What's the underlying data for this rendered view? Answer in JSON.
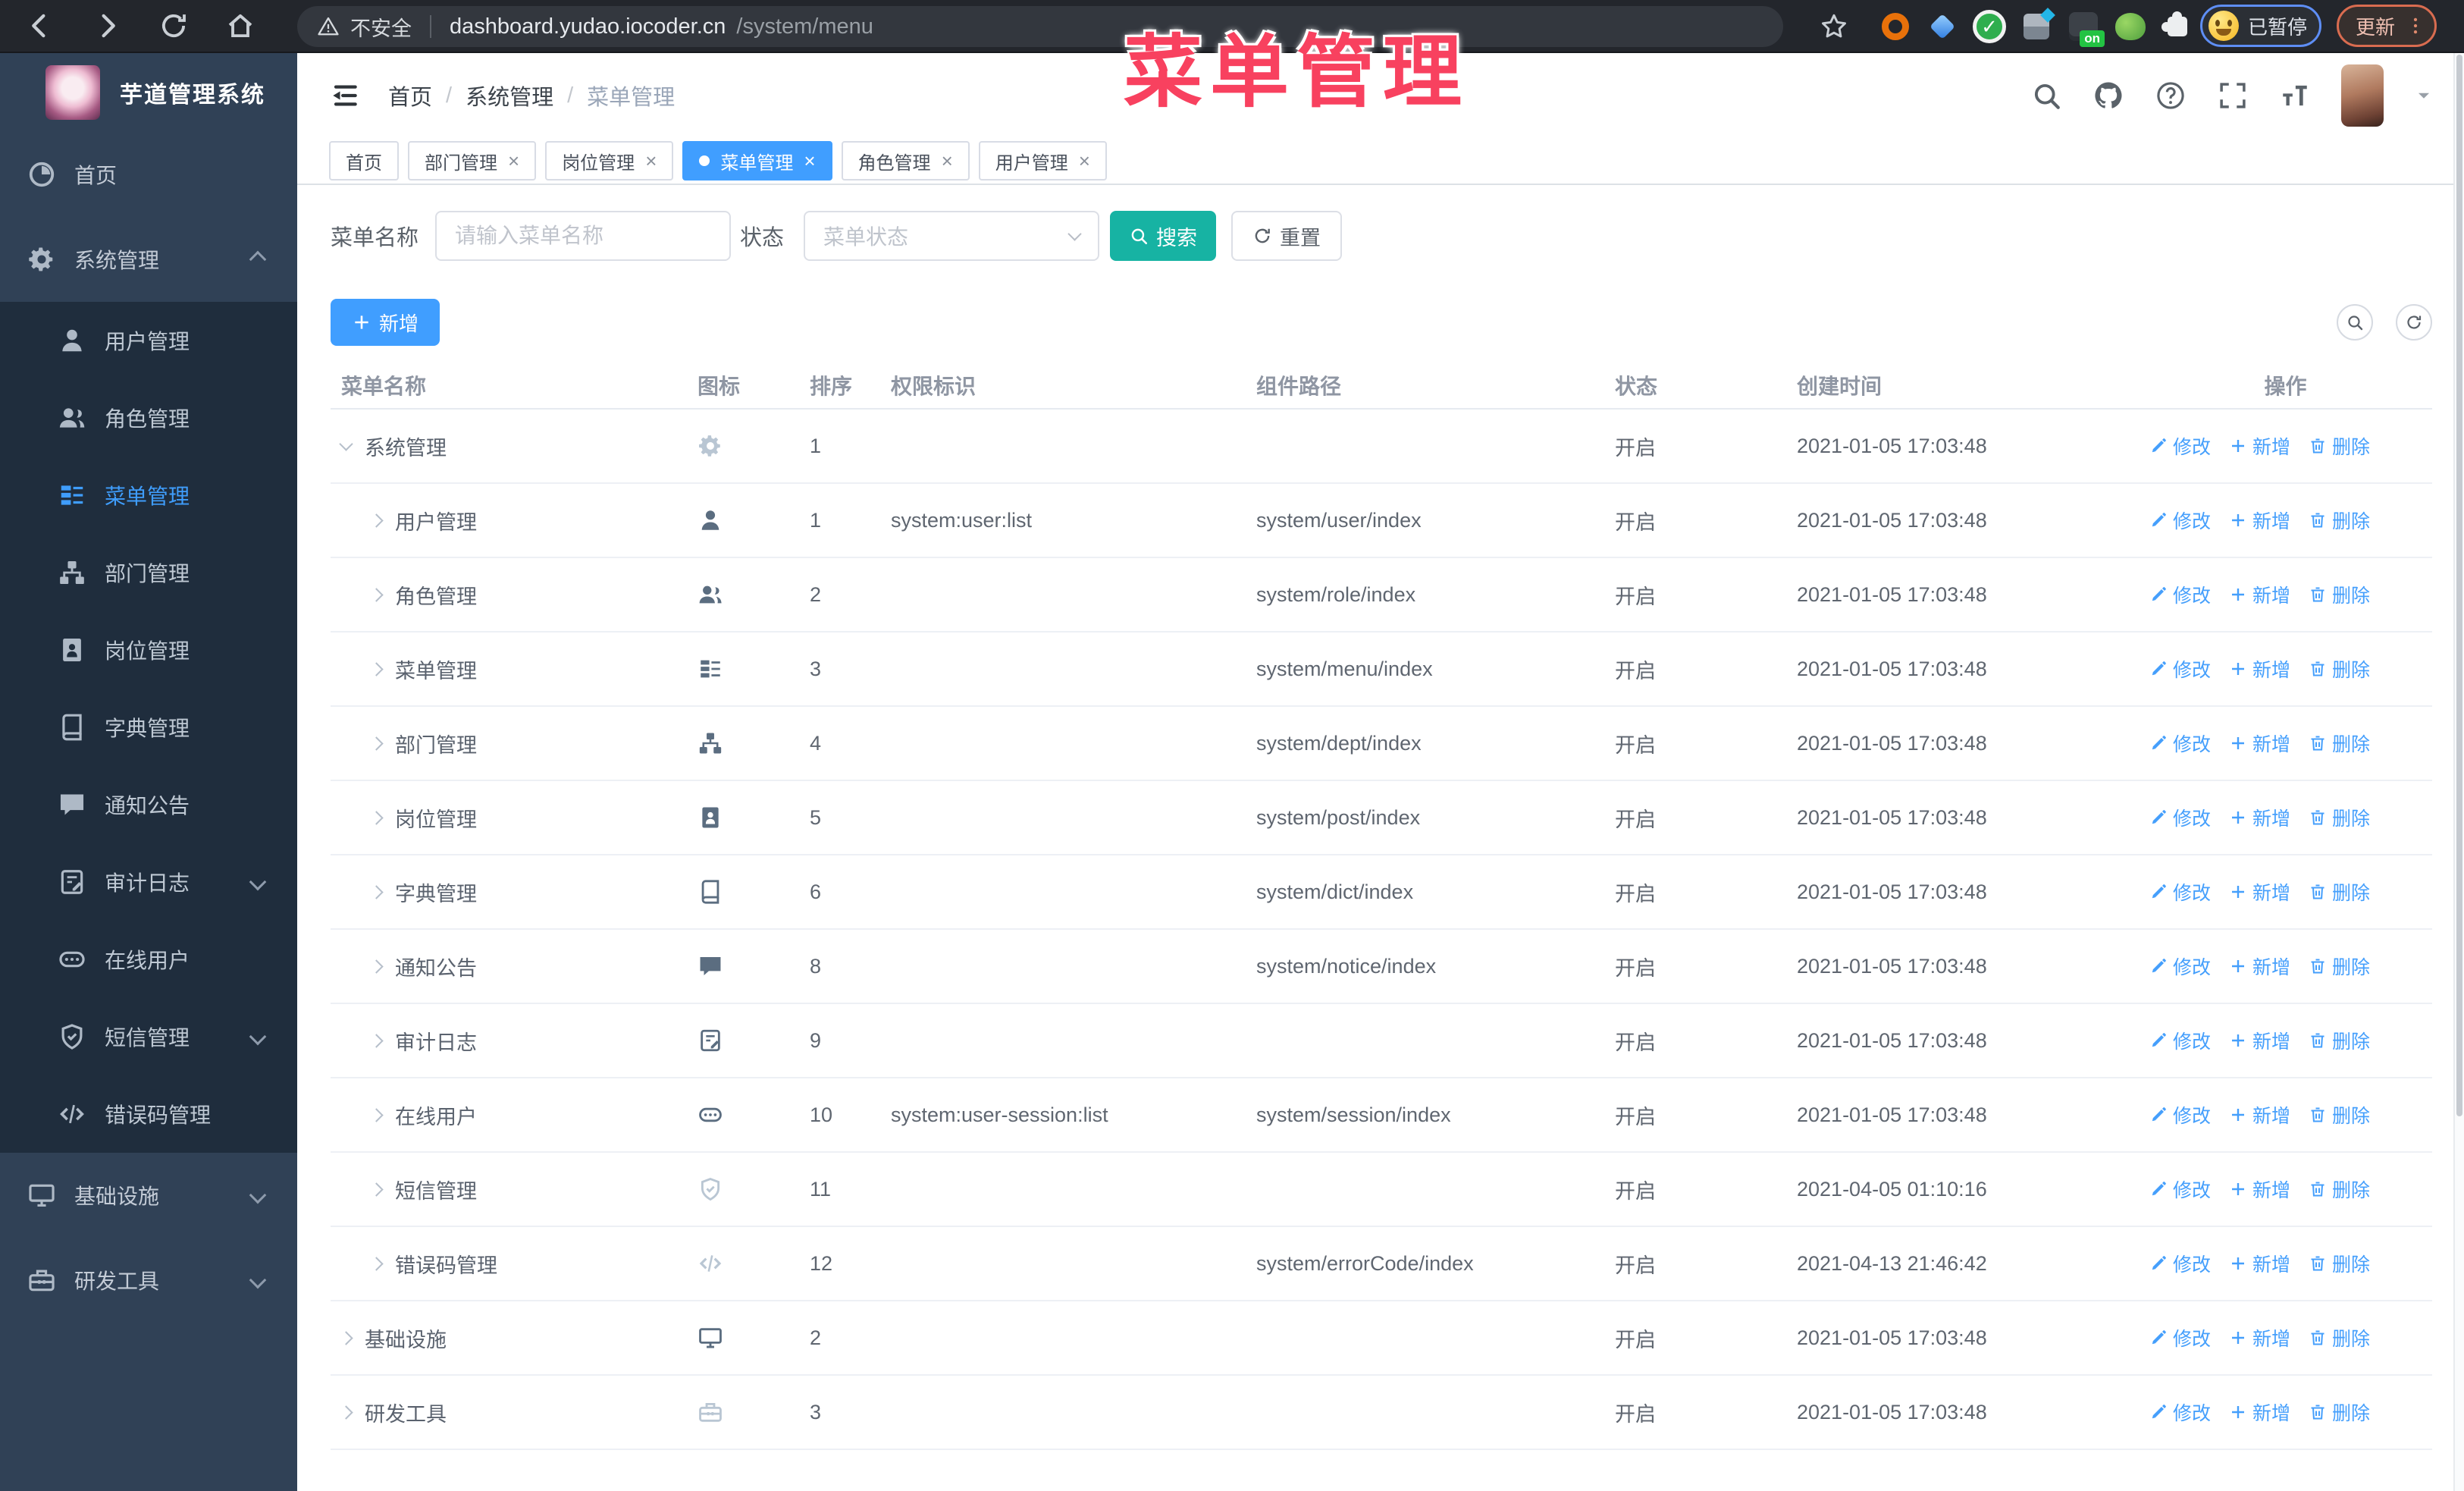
{
  "browser": {
    "security_label": "不安全",
    "url_host": "dashboard.yudao.iocoder.cn",
    "url_path": "/system/menu",
    "paused_badge": "已暂停",
    "update_button": "更新",
    "nav_icons": [
      "back-icon",
      "forward-icon",
      "reload-icon",
      "home-icon"
    ],
    "extensions": [
      "orange-ring-extension-icon",
      "blue-gem-extension-icon",
      "green-check-extension-icon",
      "tiles-extension-icon",
      "dark-on-extension-icon",
      "frog-extension-icon",
      "puzzle-extension-icon"
    ]
  },
  "annotation": {
    "text": "菜单管理",
    "color": "#f8415f"
  },
  "sidebar": {
    "title": "芋道管理系统",
    "items": [
      {
        "key": "home",
        "label": "首页",
        "icon": "dashboard-icon",
        "level": 0
      },
      {
        "key": "system",
        "label": "系统管理",
        "icon": "gear-icon",
        "level": 0,
        "chevron": "up"
      },
      {
        "key": "user",
        "label": "用户管理",
        "icon": "user-icon",
        "level": 1
      },
      {
        "key": "role",
        "label": "角色管理",
        "icon": "users-icon",
        "level": 1
      },
      {
        "key": "menu",
        "label": "菜单管理",
        "icon": "menu-tree-icon",
        "level": 1,
        "active": true
      },
      {
        "key": "dept",
        "label": "部门管理",
        "icon": "org-tree-icon",
        "level": 1
      },
      {
        "key": "post",
        "label": "岗位管理",
        "icon": "badge-icon",
        "level": 1
      },
      {
        "key": "dict",
        "label": "字典管理",
        "icon": "book-icon",
        "level": 1
      },
      {
        "key": "notice",
        "label": "通知公告",
        "icon": "message-icon",
        "level": 1
      },
      {
        "key": "audit-log",
        "label": "审计日志",
        "icon": "log-icon",
        "level": 1,
        "chevron": "down"
      },
      {
        "key": "online-user",
        "label": "在线用户",
        "icon": "online-icon",
        "level": 1
      },
      {
        "key": "sms",
        "label": "短信管理",
        "icon": "shield-icon",
        "level": 1,
        "chevron": "down"
      },
      {
        "key": "error-code",
        "label": "错误码管理",
        "icon": "code-icon",
        "level": 1
      },
      {
        "key": "infra",
        "label": "基础设施",
        "icon": "monitor-icon",
        "level": 0,
        "chevron": "down"
      },
      {
        "key": "dev-tool",
        "label": "研发工具",
        "icon": "toolbox-icon",
        "level": 0,
        "chevron": "down"
      }
    ]
  },
  "header": {
    "breadcrumb": [
      "首页",
      "系统管理",
      "菜单管理"
    ],
    "icons": [
      "search-icon",
      "github-icon",
      "question-icon",
      "fullscreen-icon",
      "font-size-icon"
    ]
  },
  "tabs": [
    {
      "key": "home",
      "label": "首页"
    },
    {
      "key": "dept",
      "label": "部门管理",
      "closable": true
    },
    {
      "key": "post",
      "label": "岗位管理",
      "closable": true
    },
    {
      "key": "menu",
      "label": "菜单管理",
      "closable": true,
      "active": true
    },
    {
      "key": "role",
      "label": "角色管理",
      "closable": true
    },
    {
      "key": "user",
      "label": "用户管理",
      "closable": true
    }
  ],
  "filters": {
    "name_label": "菜单名称",
    "name_placeholder": "请输入菜单名称",
    "status_label": "状态",
    "status_placeholder": "菜单状态",
    "search_button": "搜索",
    "reset_button": "重置"
  },
  "toolbar": {
    "add_button": "新增"
  },
  "table": {
    "columns": [
      "菜单名称",
      "图标",
      "排序",
      "权限标识",
      "组件路径",
      "状态",
      "创建时间",
      "操作"
    ],
    "ops": [
      {
        "key": "edit",
        "label": "修改",
        "icon": "edit-icon"
      },
      {
        "key": "add",
        "label": "新增",
        "icon": "plus-icon"
      },
      {
        "key": "delete",
        "label": "删除",
        "icon": "trash-icon"
      }
    ],
    "rows": [
      {
        "name": "系统管理",
        "level": 0,
        "expanded": true,
        "icon": "gear-icon",
        "icon_muted": true,
        "sort": "1",
        "perm": "",
        "path": "",
        "status": "开启",
        "time": "2021-01-05 17:03:48"
      },
      {
        "name": "用户管理",
        "level": 1,
        "expanded": false,
        "icon": "user-icon",
        "icon_muted": false,
        "sort": "1",
        "perm": "system:user:list",
        "path": "system/user/index",
        "status": "开启",
        "time": "2021-01-05 17:03:48"
      },
      {
        "name": "角色管理",
        "level": 1,
        "expanded": false,
        "icon": "users-icon",
        "icon_muted": false,
        "sort": "2",
        "perm": "",
        "path": "system/role/index",
        "status": "开启",
        "time": "2021-01-05 17:03:48"
      },
      {
        "name": "菜单管理",
        "level": 1,
        "expanded": false,
        "icon": "menu-tree-icon",
        "icon_muted": false,
        "sort": "3",
        "perm": "",
        "path": "system/menu/index",
        "status": "开启",
        "time": "2021-01-05 17:03:48"
      },
      {
        "name": "部门管理",
        "level": 1,
        "expanded": false,
        "icon": "org-tree-icon",
        "icon_muted": false,
        "sort": "4",
        "perm": "",
        "path": "system/dept/index",
        "status": "开启",
        "time": "2021-01-05 17:03:48"
      },
      {
        "name": "岗位管理",
        "level": 1,
        "expanded": false,
        "icon": "badge-icon",
        "icon_muted": false,
        "sort": "5",
        "perm": "",
        "path": "system/post/index",
        "status": "开启",
        "time": "2021-01-05 17:03:48"
      },
      {
        "name": "字典管理",
        "level": 1,
        "expanded": false,
        "icon": "book-icon",
        "icon_muted": false,
        "sort": "6",
        "perm": "",
        "path": "system/dict/index",
        "status": "开启",
        "time": "2021-01-05 17:03:48"
      },
      {
        "name": "通知公告",
        "level": 1,
        "expanded": false,
        "icon": "message-icon",
        "icon_muted": false,
        "sort": "8",
        "perm": "",
        "path": "system/notice/index",
        "status": "开启",
        "time": "2021-01-05 17:03:48"
      },
      {
        "name": "审计日志",
        "level": 1,
        "expanded": false,
        "icon": "log-icon",
        "icon_muted": false,
        "sort": "9",
        "perm": "",
        "path": "",
        "status": "开启",
        "time": "2021-01-05 17:03:48"
      },
      {
        "name": "在线用户",
        "level": 1,
        "expanded": false,
        "icon": "online-icon",
        "icon_muted": false,
        "sort": "10",
        "perm": "system:user-session:list",
        "path": "system/session/index",
        "status": "开启",
        "time": "2021-01-05 17:03:48"
      },
      {
        "name": "短信管理",
        "level": 1,
        "expanded": false,
        "icon": "shield-icon",
        "icon_muted": true,
        "sort": "11",
        "perm": "",
        "path": "",
        "status": "开启",
        "time": "2021-04-05 01:10:16"
      },
      {
        "name": "错误码管理",
        "level": 1,
        "expanded": false,
        "icon": "code-icon",
        "icon_muted": true,
        "sort": "12",
        "perm": "",
        "path": "system/errorCode/index",
        "status": "开启",
        "time": "2021-04-13 21:46:42"
      },
      {
        "name": "基础设施",
        "level": 0,
        "expanded": false,
        "icon": "monitor-icon",
        "icon_muted": false,
        "sort": "2",
        "perm": "",
        "path": "",
        "status": "开启",
        "time": "2021-01-05 17:03:48"
      },
      {
        "name": "研发工具",
        "level": 0,
        "expanded": false,
        "icon": "toolbox-icon",
        "icon_muted": true,
        "sort": "3",
        "perm": "",
        "path": "",
        "status": "开启",
        "time": "2021-01-05 17:03:48"
      }
    ]
  },
  "colors": {
    "accent": "#409eff",
    "search_button": "#17b3a3",
    "sidebar_bg": "#304156",
    "submenu_bg": "#1f2d3d",
    "annotation": "#f8415f"
  }
}
